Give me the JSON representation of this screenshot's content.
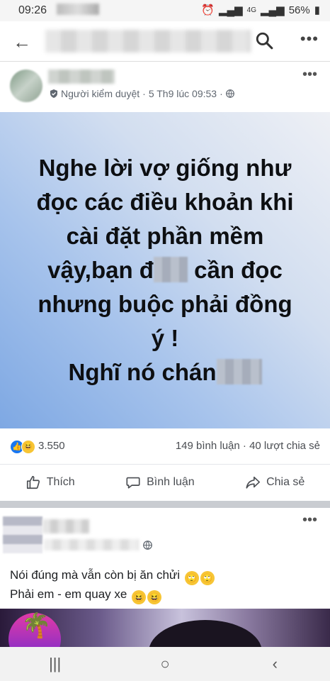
{
  "status_bar": {
    "time": "09:26",
    "network": "4G",
    "battery": "56%"
  },
  "top_bar": {
    "back_icon": "arrow-left-icon",
    "search_icon": "search-icon",
    "more_icon": "more-horizontal-icon"
  },
  "post": {
    "meta_role": "Người kiểm duyệt",
    "meta_sep": "·",
    "meta_time": "5 Th9 lúc 09:53",
    "meta_sep2": "·",
    "poster_lines": {
      "l1": "Nghe lời vợ giống như",
      "l2": "đọc các điều khoản khi",
      "l3": "cài đặt phần mềm",
      "l4a": "vậy,bạn đ",
      "l4b": " cần đọc",
      "l5": "nhưng buộc phải đồng",
      "l6": "ý !",
      "l7": "Nghĩ nó chán"
    },
    "reactions_count": "3.550",
    "comments_shares": "149 bình luận · 40 lượt chia sẻ",
    "actions": {
      "like": "Thích",
      "comment": "Bình luận",
      "share": "Chia sẻ"
    }
  },
  "post2": {
    "line1": "Nói đúng mà vẫn còn bị ăn chửi",
    "line2": "Phải em - em quay xe"
  },
  "navbar": {
    "recents": "|||",
    "home": "○",
    "back": "‹"
  },
  "colors": {
    "accent": "#1877f2",
    "poster_gradient_start": "#7ea8e3",
    "poster_gradient_end": "#eef0f5"
  }
}
